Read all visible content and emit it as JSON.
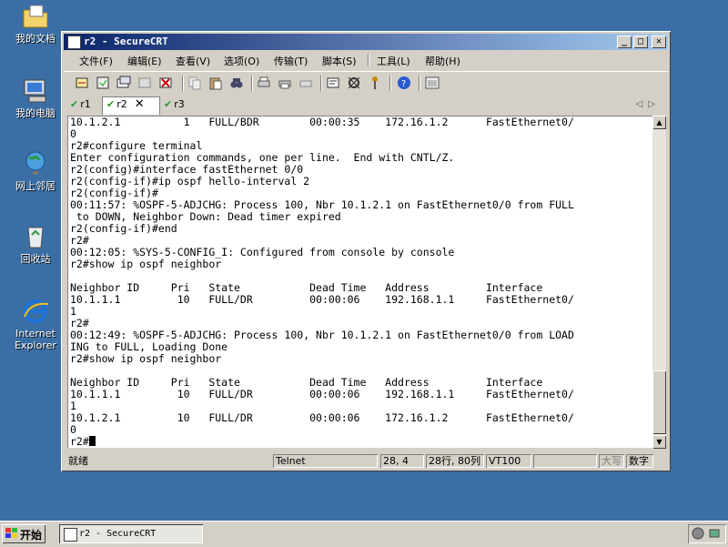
{
  "desktop": {
    "icons": [
      {
        "label": "我的文档"
      },
      {
        "label": "我的电脑"
      },
      {
        "label": "网上邻居"
      },
      {
        "label": "回收站"
      },
      {
        "label": "Internet Explorer"
      }
    ]
  },
  "window": {
    "title": "r2 - SecureCRT",
    "menu": [
      "文件(F)",
      "编辑(E)",
      "查看(V)",
      "选项(O)",
      "传输(T)",
      "脚本(S)",
      "工具(L)",
      "帮助(H)"
    ],
    "tabs": [
      {
        "label": "r1",
        "active": false
      },
      {
        "label": "r2",
        "active": true
      },
      {
        "label": "r3",
        "active": false
      }
    ],
    "terminal_lines": [
      "10.1.2.1          1   FULL/BDR        00:00:35    172.16.1.2      FastEthernet0/",
      "0",
      "r2#configure terminal",
      "Enter configuration commands, one per line.  End with CNTL/Z.",
      "r2(config)#interface fastEthernet 0/0",
      "r2(config-if)#ip ospf hello-interval 2",
      "r2(config-if)#",
      "00:11:57: %OSPF-5-ADJCHG: Process 100, Nbr 10.1.2.1 on FastEthernet0/0 from FULL",
      " to DOWN, Neighbor Down: Dead timer expired",
      "r2(config-if)#end",
      "r2#",
      "00:12:05: %SYS-5-CONFIG_I: Configured from console by console",
      "r2#show ip ospf neighbor",
      "",
      "Neighbor ID     Pri   State           Dead Time   Address         Interface",
      "10.1.1.1         10   FULL/DR         00:00:06    192.168.1.1     FastEthernet0/",
      "1",
      "r2#",
      "00:12:49: %OSPF-5-ADJCHG: Process 100, Nbr 10.1.2.1 on FastEthernet0/0 from LOAD",
      "ING to FULL, Loading Done",
      "r2#show ip ospf neighbor",
      "",
      "Neighbor ID     Pri   State           Dead Time   Address         Interface",
      "10.1.1.1         10   FULL/DR         00:00:06    192.168.1.1     FastEthernet0/",
      "1",
      "10.1.2.1         10   FULL/DR         00:00:06    172.16.1.2      FastEthernet0/",
      "0"
    ],
    "prompt": "r2#",
    "status": {
      "ready": "就绪",
      "protocol": "Telnet",
      "cursor_pos": "28,  4",
      "size": "28行, 80列",
      "emulation": "VT100",
      "caps": "大写",
      "num": "数字"
    }
  },
  "taskbar": {
    "start_label": "开始",
    "task_label": "r2 - SecureCRT"
  }
}
